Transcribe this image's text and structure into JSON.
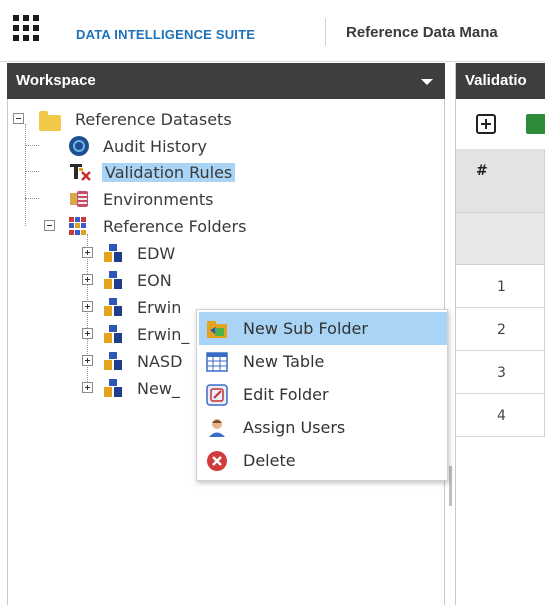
{
  "header": {
    "brand": "DATA INTELLIGENCE SUITE",
    "module_title": "Reference Data Mana"
  },
  "workspace": {
    "title": "Workspace",
    "tree": [
      {
        "label": "Reference Datasets",
        "icon": "folder-icon"
      },
      {
        "label": "Audit History",
        "icon": "globe-icon"
      },
      {
        "label": "Validation Rules",
        "icon": "validation-rules-icon",
        "selected": true
      },
      {
        "label": "Environments",
        "icon": "environments-icon"
      },
      {
        "label": "Reference Folders",
        "icon": "grid-icon"
      },
      {
        "label": "EDW",
        "icon": "folder-users-icon"
      },
      {
        "label": "EON",
        "icon": "folder-users-icon"
      },
      {
        "label": "Erwin",
        "icon": "folder-users-icon"
      },
      {
        "label": "Erwin_",
        "icon": "folder-users-icon"
      },
      {
        "label": "NASD",
        "icon": "folder-users-icon"
      },
      {
        "label": "New_",
        "icon": "folder-users-icon"
      }
    ]
  },
  "right_panel": {
    "title": "Validatio",
    "column_header": "#",
    "rows": [
      "1",
      "2",
      "3",
      "4"
    ]
  },
  "context_menu": {
    "items": [
      {
        "label": "New Sub Folder",
        "icon": "new-sub-folder-icon",
        "highlighted": true
      },
      {
        "label": "New Table",
        "icon": "table-icon"
      },
      {
        "label": "Edit Folder",
        "icon": "edit-icon"
      },
      {
        "label": "Assign Users",
        "icon": "user-icon"
      },
      {
        "label": "Delete",
        "icon": "delete-icon"
      }
    ]
  },
  "colors": {
    "header_bg": "#3e3e3e",
    "brand": "#1e73b8",
    "selection": "#a9d4f5"
  }
}
